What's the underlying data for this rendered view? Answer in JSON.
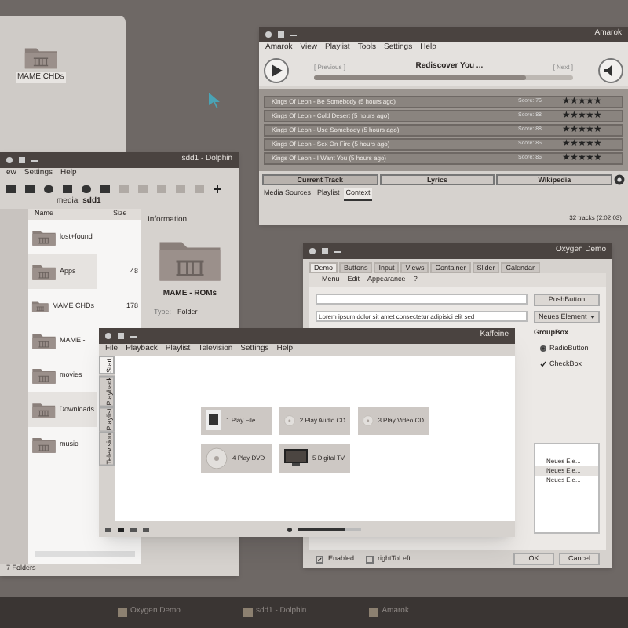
{
  "folder_panel": {
    "icons": [
      {
        "label": "MAME CHDs"
      }
    ]
  },
  "amarok": {
    "title": "Amarok",
    "menu": [
      "Amarok",
      "View",
      "Playlist",
      "Tools",
      "Settings",
      "Help"
    ],
    "previous": "[ Previous ]",
    "now_playing": "Rediscover You ...",
    "next": "[ Next ]",
    "progress": {
      "level": 0.82
    },
    "tracks": [
      {
        "title": "Kings Of Leon - Be Somebody (5 hours ago)",
        "score": "Score: 76",
        "stars": 5
      },
      {
        "title": "Kings Of Leon - Cold Desert (5 hours ago)",
        "score": "Score: 88",
        "stars": 5
      },
      {
        "title": "Kings Of Leon - Use Somebody (5 hours ago)",
        "score": "Score: 88",
        "stars": 5
      },
      {
        "title": "Kings Of Leon - Sex On Fire (5 hours ago)",
        "score": "Score: 86",
        "stars": 5
      },
      {
        "title": "Kings Of Leon - I Want You (5 hours ago)",
        "score": "Score: 86",
        "stars": 5
      }
    ],
    "context_tabs": [
      {
        "label": "Current Track",
        "selected": true
      },
      {
        "label": "Lyrics",
        "selected": false
      },
      {
        "label": "Wikipedia",
        "selected": false
      }
    ],
    "source_tabs": [
      {
        "label": "Media Sources",
        "selected": false
      },
      {
        "label": "Playlist",
        "selected": false
      },
      {
        "label": "Context",
        "selected": true
      }
    ],
    "status": "32 tracks (2:02:03)"
  },
  "dolphin": {
    "title": "sdd1 - Dolphin",
    "menu": [
      "ew",
      "Settings",
      "Help"
    ],
    "breadcrumb": [
      "media",
      "sdd1"
    ],
    "columns": [
      "Name",
      "Size"
    ],
    "files": [
      {
        "name": "lost+found",
        "selected": false
      },
      {
        "name": "Apps",
        "size": "48",
        "selected": true
      },
      {
        "name": "MAME CHDs",
        "size": "178",
        "selected": false
      },
      {
        "name": "MAME -",
        "selected": false
      },
      {
        "name": "movies",
        "selected": false
      },
      {
        "name": "Downloads",
        "selected": true
      },
      {
        "name": "music",
        "selected": false
      }
    ],
    "info": {
      "heading": "Information",
      "name": "MAME - ROMs",
      "type_label": "Type:",
      "type_value": "Folder"
    },
    "status": "7 Folders"
  },
  "demo": {
    "title": "Oxygen Demo",
    "tabs": [
      {
        "label": "Demo",
        "selected": true
      },
      {
        "label": "Buttons",
        "selected": false
      },
      {
        "label": "Input",
        "selected": false
      },
      {
        "label": "Views",
        "selected": false
      },
      {
        "label": "Container",
        "selected": false
      },
      {
        "label": "Slider",
        "selected": false
      },
      {
        "label": "Calendar",
        "selected": false
      }
    ],
    "toolbar": [
      "Menu",
      "Edit",
      "Appearance",
      "?"
    ],
    "text": "Lorem ipsum dolor sit amet consectetur adipisici elit sed",
    "push_button": "PushButton",
    "combo": "Neues Element",
    "groupbox": "GroupBox",
    "radio": {
      "label": "RadioButton",
      "checked": true
    },
    "checkbox": {
      "label": "CheckBox",
      "checked": true
    },
    "list": [
      {
        "label": "Neues Ele...",
        "selected": false
      },
      {
        "label": "Neues Ele...",
        "selected": true
      },
      {
        "label": "Neues Ele...",
        "selected": false
      }
    ],
    "enabled": {
      "label": "Enabled",
      "checked": true
    },
    "rtl": {
      "label": "rightToLeft",
      "checked": false
    },
    "buttons": [
      "OK",
      "Cancel"
    ]
  },
  "kaffeine": {
    "title": "Kaffeine",
    "menu": [
      "File",
      "Playback",
      "Playlist",
      "Television",
      "Settings",
      "Help"
    ],
    "side_tabs": [
      {
        "label": "Start",
        "selected": true
      },
      {
        "label": "Playback",
        "selected": false
      },
      {
        "label": "Playlist",
        "selected": false
      },
      {
        "label": "Television",
        "selected": false
      }
    ],
    "actions": [
      {
        "label": "1 Play File",
        "kind": "file"
      },
      {
        "label": "2 Play Audio CD",
        "kind": "disc"
      },
      {
        "label": "3 Play Video CD",
        "kind": "disc"
      },
      {
        "label": "4 Play DVD",
        "kind": "disc"
      },
      {
        "label": "5 Digital TV",
        "kind": "tv"
      }
    ],
    "volume": {
      "level": 0.75
    }
  },
  "taskbar": {
    "items": [
      {
        "label": "Oxygen Demo"
      },
      {
        "label": "sdd1 - Dolphin"
      },
      {
        "label": "Amarok"
      }
    ]
  }
}
